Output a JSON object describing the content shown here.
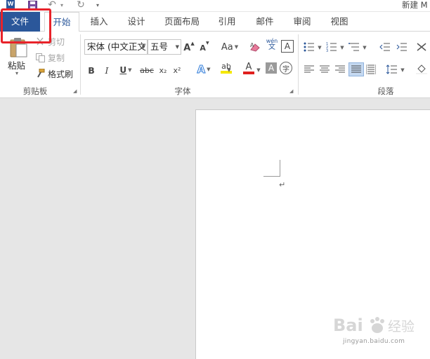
{
  "titlebar": {
    "app_icon_letter": "W",
    "doc_title": "新建 M"
  },
  "tabs": [
    {
      "label": "文件"
    },
    {
      "label": "开始"
    },
    {
      "label": "插入"
    },
    {
      "label": "设计"
    },
    {
      "label": "页面布局"
    },
    {
      "label": "引用"
    },
    {
      "label": "邮件"
    },
    {
      "label": "审阅"
    },
    {
      "label": "视图"
    }
  ],
  "clipboard": {
    "paste_label": "粘贴",
    "cut_label": "剪切",
    "copy_label": "复制",
    "format_painter_label": "格式刷",
    "group_label": "剪贴板"
  },
  "font": {
    "font_name": "宋体 (中文正文",
    "font_size": "五号",
    "bold": "B",
    "italic": "I",
    "underline": "U",
    "strikethrough": "abc",
    "subscript": "x₂",
    "superscript": "x²",
    "grow_font": "A",
    "shrink_font": "A",
    "change_case": "Aa",
    "phonetic_top": "wén",
    "phonetic_bottom": "文",
    "char_border": "A",
    "text_effects": "A",
    "highlight": "ab",
    "font_color": "A",
    "char_shading": "A",
    "enclose_char": "字",
    "group_label": "字体",
    "highlight_color": "#f5e800",
    "font_color_value": "#e0201e"
  },
  "paragraph": {
    "group_label": "段落"
  },
  "watermark": {
    "brand": "Bai",
    "brand_cn": "经验",
    "url": "jingyan.baidu.com"
  },
  "accent_color": "#2b579a",
  "highlight_box_color": "#e8222a"
}
